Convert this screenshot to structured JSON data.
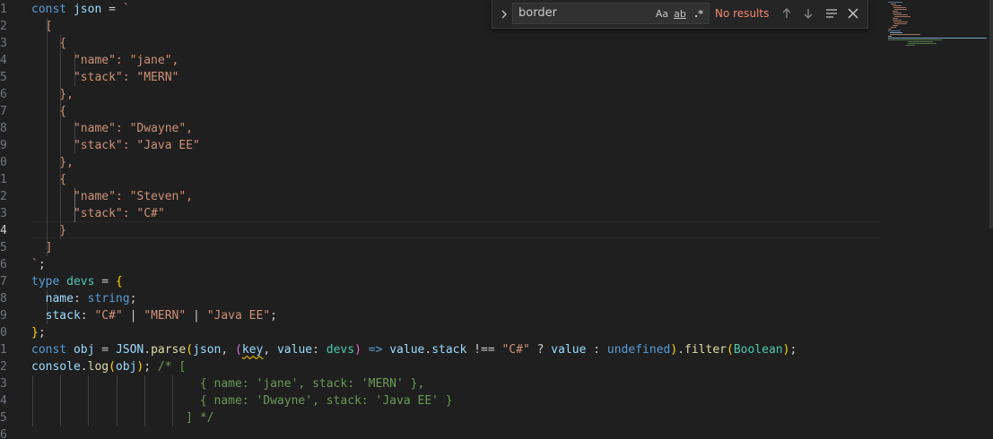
{
  "editor": {
    "line_numbers": [
      "1",
      "2",
      "3",
      "4",
      "5",
      "6",
      "7",
      "8",
      "9",
      "0",
      "1",
      "2",
      "3",
      "4",
      "5",
      "6",
      "7",
      "8",
      "9",
      "0",
      "1",
      "2",
      "3",
      "4",
      "5",
      "6"
    ],
    "active_line_index": 13,
    "lines": [
      [
        [
          "k",
          "const "
        ],
        [
          "v",
          "json"
        ],
        [
          "p",
          " = "
        ],
        [
          "s",
          "`"
        ]
      ],
      [
        [
          "s",
          "  ["
        ]
      ],
      [
        [
          "s",
          "    {"
        ]
      ],
      [
        [
          "s",
          "      \"name\": \"jane\","
        ]
      ],
      [
        [
          "s",
          "      \"stack\": \"MERN\""
        ]
      ],
      [
        [
          "s",
          "    },"
        ]
      ],
      [
        [
          "s",
          "    {"
        ]
      ],
      [
        [
          "s",
          "      \"name\": \"Dwayne\","
        ]
      ],
      [
        [
          "s",
          "      \"stack\": \"Java EE\""
        ]
      ],
      [
        [
          "s",
          "    },"
        ]
      ],
      [
        [
          "s",
          "    {"
        ]
      ],
      [
        [
          "s",
          "      \"name\": \"Steven\","
        ]
      ],
      [
        [
          "s",
          "      \"stack\": \"C#\""
        ]
      ],
      [
        [
          "s",
          "    }"
        ]
      ],
      [
        [
          "s",
          "  ]"
        ]
      ],
      [
        [
          "s",
          "`"
        ],
        [
          "p",
          ";"
        ]
      ],
      [
        [
          "k",
          "type "
        ],
        [
          "t",
          "devs"
        ],
        [
          "p",
          " = "
        ],
        [
          "b1",
          "{"
        ]
      ],
      [
        [
          "p",
          "  "
        ],
        [
          "v",
          "name"
        ],
        [
          "p",
          ": "
        ],
        [
          "k",
          "string"
        ],
        [
          "p",
          ";"
        ]
      ],
      [
        [
          "p",
          "  "
        ],
        [
          "v",
          "stack"
        ],
        [
          "p",
          ": "
        ],
        [
          "s",
          "\"C#\""
        ],
        [
          "p",
          " | "
        ],
        [
          "s",
          "\"MERN\""
        ],
        [
          "p",
          " | "
        ],
        [
          "s",
          "\"Java EE\""
        ],
        [
          "p",
          ";"
        ]
      ],
      [
        [
          "b1",
          "}"
        ],
        [
          "p",
          ";"
        ]
      ],
      [
        [
          "k",
          "const "
        ],
        [
          "v",
          "obj"
        ],
        [
          "p",
          " = "
        ],
        [
          "v",
          "JSON"
        ],
        [
          "p",
          "."
        ],
        [
          "f",
          "parse"
        ],
        [
          "b1",
          "("
        ],
        [
          "v",
          "json"
        ],
        [
          "p",
          ", "
        ],
        [
          "b2",
          "("
        ],
        [
          "sqv",
          "key"
        ],
        [
          "p",
          ", "
        ],
        [
          "v",
          "value"
        ],
        [
          "p",
          ": "
        ],
        [
          "t",
          "devs"
        ],
        [
          "b2",
          ")"
        ],
        [
          "p",
          " "
        ],
        [
          "k",
          "=>"
        ],
        [
          "p",
          " "
        ],
        [
          "v",
          "value"
        ],
        [
          "p",
          "."
        ],
        [
          "v",
          "stack"
        ],
        [
          "p",
          " !== "
        ],
        [
          "s",
          "\"C#\""
        ],
        [
          "p",
          " ? "
        ],
        [
          "v",
          "value"
        ],
        [
          "p",
          " : "
        ],
        [
          "k",
          "undefined"
        ],
        [
          "b1",
          ")"
        ],
        [
          "p",
          "."
        ],
        [
          "f",
          "filter"
        ],
        [
          "b1",
          "("
        ],
        [
          "t",
          "Boolean"
        ],
        [
          "b1",
          ")"
        ],
        [
          "p",
          ";"
        ]
      ],
      [
        [
          "v",
          "console"
        ],
        [
          "p",
          "."
        ],
        [
          "f",
          "log"
        ],
        [
          "b1",
          "("
        ],
        [
          "v",
          "obj"
        ],
        [
          "b1",
          ")"
        ],
        [
          "p",
          "; "
        ],
        [
          "c",
          "/* ["
        ]
      ],
      [
        [
          "c",
          "                        { name: 'jane', stack: 'MERN' },"
        ]
      ],
      [
        [
          "c",
          "                        { name: 'Dwayne', stack: 'Java EE' }"
        ]
      ],
      [
        [
          "c",
          "                      ] */"
        ]
      ],
      [
        [
          "p",
          ""
        ]
      ]
    ]
  },
  "find_widget": {
    "query": "border",
    "match_case_label": "Aa",
    "whole_word_label": "ab",
    "regex_label": ".*",
    "status": "No results",
    "toggle_icon": "chevron-right-icon",
    "prev_icon": "arrow-up-icon",
    "next_icon": "arrow-down-icon",
    "selection_icon": "find-in-selection-icon",
    "close_icon": "close-icon",
    "status_color": "#f48771"
  },
  "colors": {
    "background": "#1f1f1f",
    "keyword": "#569cd6",
    "string": "#ce9178",
    "variable": "#9cdcfe",
    "type": "#4ec9b0",
    "function": "#dcdcaa",
    "comment": "#6a9955"
  }
}
